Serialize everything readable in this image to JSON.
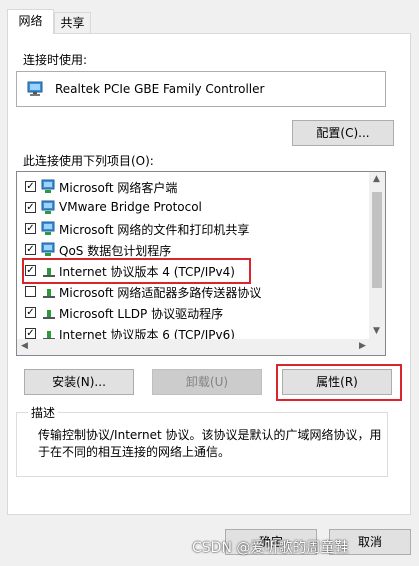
{
  "tabs": [
    {
      "label": "网络"
    },
    {
      "label": "共享"
    }
  ],
  "connect_using_label": "连接时使用:",
  "adapter_name": "Realtek PCIe GBE Family Controller",
  "configure_button": "配置(C)...",
  "items_label": "此连接使用下列项目(O):",
  "items": [
    {
      "label": "Microsoft 网络客户端",
      "checked": true,
      "icon": "network-client-icon"
    },
    {
      "label": "VMware Bridge Protocol",
      "checked": true,
      "icon": "network-client-icon"
    },
    {
      "label": "Microsoft 网络的文件和打印机共享",
      "checked": true,
      "icon": "network-client-icon"
    },
    {
      "label": "QoS 数据包计划程序",
      "checked": true,
      "icon": "network-client-icon"
    },
    {
      "label": "Internet 协议版本 4 (TCP/IPv4)",
      "checked": true,
      "icon": "protocol-icon"
    },
    {
      "label": "Microsoft 网络适配器多路传送器协议",
      "checked": false,
      "icon": "protocol-icon"
    },
    {
      "label": "Microsoft LLDP 协议驱动程序",
      "checked": true,
      "icon": "protocol-icon"
    },
    {
      "label": "Internet 协议版本 6 (TCP/IPv6)",
      "checked": true,
      "icon": "protocol-icon"
    }
  ],
  "install_button": "安装(N)...",
  "uninstall_button": "卸载(U)",
  "properties_button": "属性(R)",
  "description_title": "描述",
  "description_text": "传输控制协议/Internet 协议。该协议是默认的广域网络协议，用于在不同的相互连接的网络上通信。",
  "ok_button": "确定",
  "cancel_button": "取消",
  "watermark": "CSDN @爱听歌的周童鞋",
  "colors": {
    "highlight": "#d9252b",
    "button": "#e1e1e1"
  }
}
